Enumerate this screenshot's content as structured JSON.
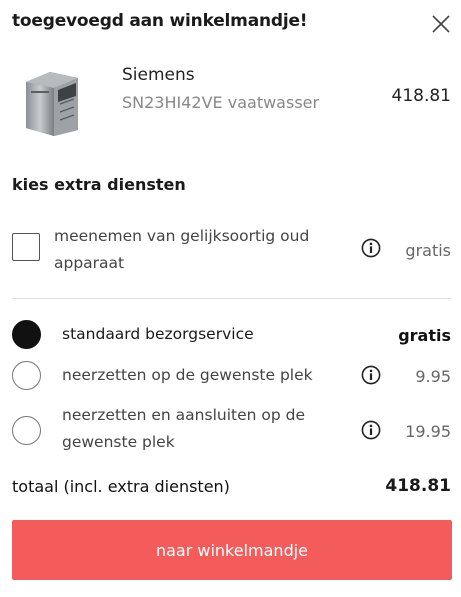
{
  "modal": {
    "title": "toegevoegd aan winkelmandje!",
    "close_icon": "close-icon"
  },
  "product": {
    "brand": "Siemens",
    "model": "SN23HI42VE vaatwasser",
    "price": "418.81",
    "image_icon": "dishwasher-image"
  },
  "services": {
    "title": "kies extra diensten",
    "takeback": {
      "label_line1": "meenemen van gelijksoortig oud",
      "label_line2": "apparaat",
      "price": "gratis",
      "checked": false
    },
    "delivery": [
      {
        "label_line1": "standaard bezorgservice",
        "label_line2": "",
        "price": "gratis",
        "selected": true
      },
      {
        "label_line1": "neerzetten op de gewenste plek",
        "label_line2": "",
        "price": "9.95",
        "selected": false
      },
      {
        "label_line1": "neerzetten en aansluiten op de",
        "label_line2": "gewenste plek",
        "price": "19.95",
        "selected": false
      }
    ]
  },
  "total": {
    "label": "totaal (incl. extra diensten)",
    "value": "418.81"
  },
  "cta": {
    "label": "naar winkelmandje"
  },
  "colors": {
    "cta_background": "#f45b5b",
    "text_primary": "#1a1a1a",
    "text_muted": "#888888"
  }
}
